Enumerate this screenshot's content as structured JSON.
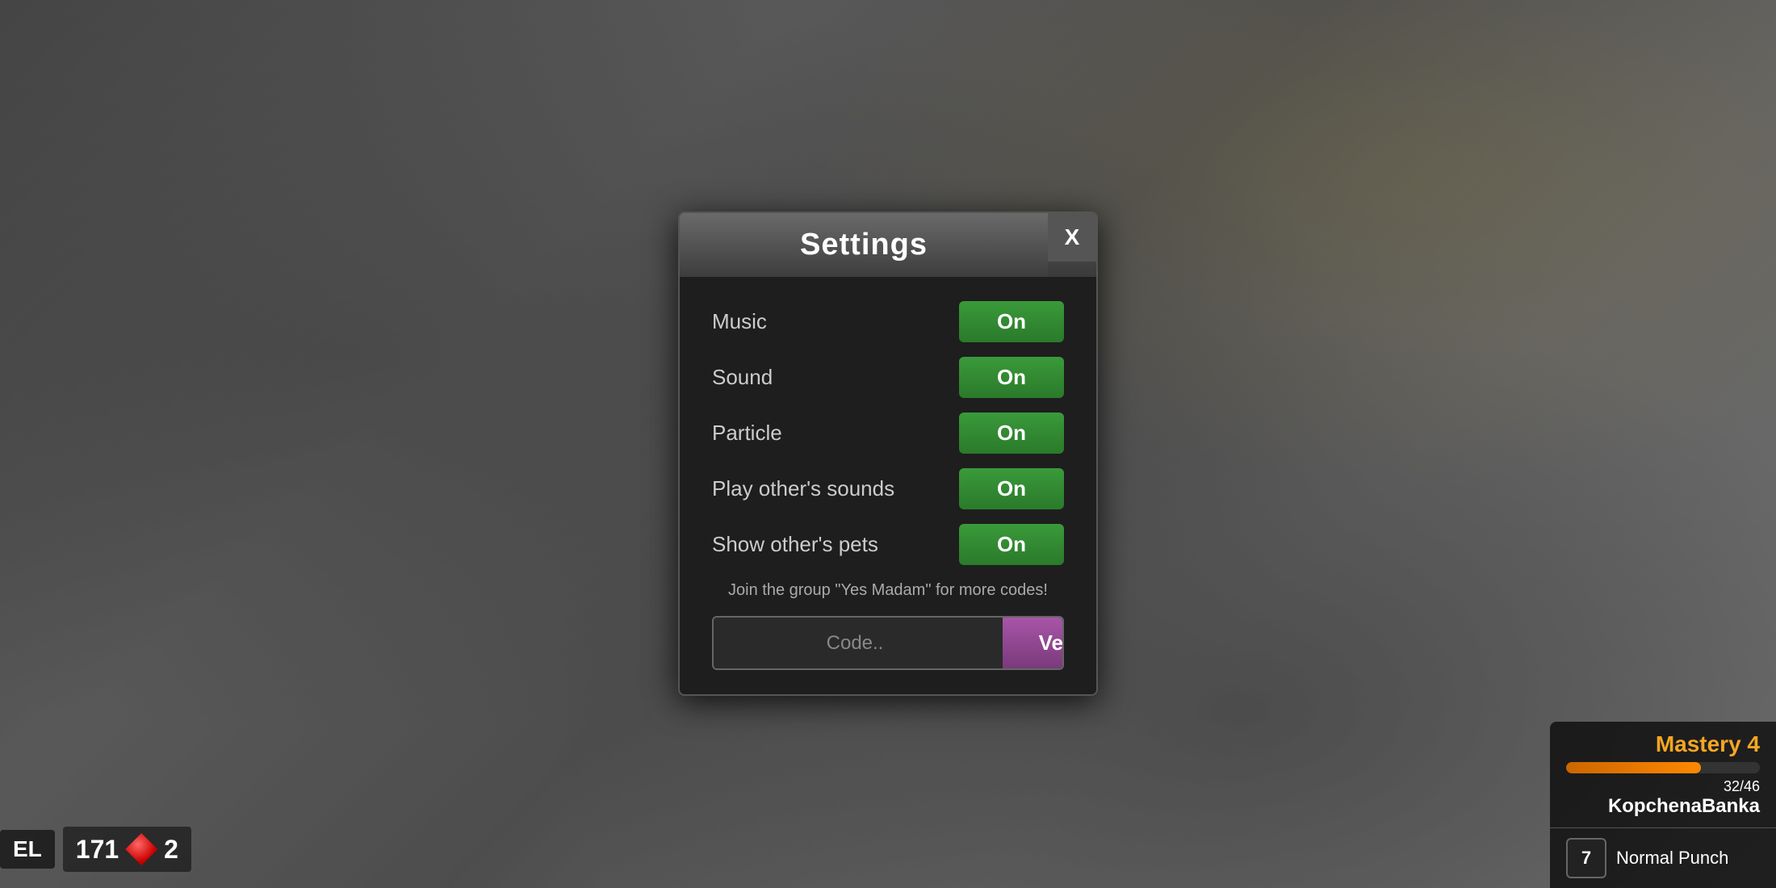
{
  "background": {
    "description": "blurred city street game background"
  },
  "modal": {
    "title": "Settings",
    "close_label": "X",
    "settings": [
      {
        "id": "music",
        "label": "Music",
        "value": "On"
      },
      {
        "id": "sound",
        "label": "Sound",
        "value": "On"
      },
      {
        "id": "particle",
        "label": "Particle",
        "value": "On"
      },
      {
        "id": "play-others-sounds",
        "label": "Play other's sounds",
        "value": "On"
      },
      {
        "id": "show-others-pets",
        "label": "Show other's pets",
        "value": "On"
      }
    ],
    "promo_text": "Join the group \"Yes Madam\" for more codes!",
    "code_placeholder": "Code..",
    "verify_label": "Verify"
  },
  "hud": {
    "bottom_left": {
      "level_label": "EL",
      "currency_amount": "171",
      "gem_count": "2"
    },
    "bottom_right": {
      "mastery_title": "Mastery 4",
      "mastery_current": "32",
      "mastery_max": "46",
      "mastery_progress_text": "32/46",
      "player_name": "KopchenaBanka",
      "skill_key": "7",
      "skill_name": "Normal Punch"
    }
  }
}
